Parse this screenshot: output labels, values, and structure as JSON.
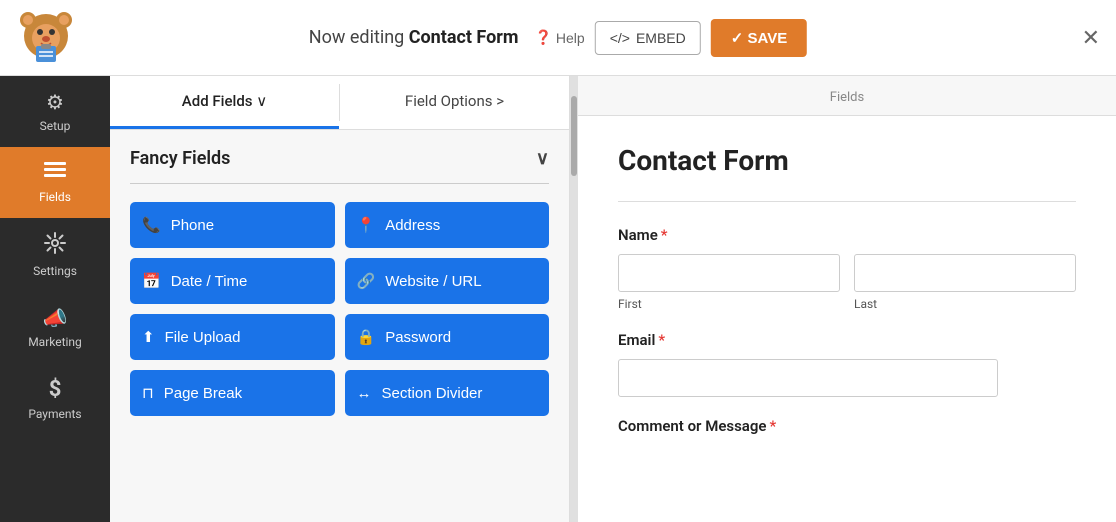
{
  "topbar": {
    "title_prefix": "Now editing ",
    "title_bold": "Contact Form",
    "help_label": "Help",
    "embed_label": "EMBED",
    "save_label": "✓ SAVE",
    "close_label": "✕"
  },
  "sidebar": {
    "items": [
      {
        "id": "setup",
        "label": "Setup",
        "icon": "⚙"
      },
      {
        "id": "fields",
        "label": "Fields",
        "icon": "≡",
        "active": true
      },
      {
        "id": "settings",
        "label": "Settings",
        "icon": "⊞"
      },
      {
        "id": "marketing",
        "label": "Marketing",
        "icon": "📣"
      },
      {
        "id": "payments",
        "label": "Payments",
        "icon": "$"
      }
    ]
  },
  "fields_panel": {
    "tabs": [
      {
        "id": "add-fields",
        "label": "Add Fields ∨",
        "active": true
      },
      {
        "id": "field-options",
        "label": "Field Options >"
      }
    ],
    "fancy_fields_label": "Fancy Fields",
    "buttons": [
      {
        "id": "phone",
        "label": "Phone",
        "icon": "📞"
      },
      {
        "id": "address",
        "label": "Address",
        "icon": "📍"
      },
      {
        "id": "datetime",
        "label": "Date / Time",
        "icon": "📅"
      },
      {
        "id": "website",
        "label": "Website / URL",
        "icon": "🔗"
      },
      {
        "id": "file-upload",
        "label": "File Upload",
        "icon": "⬆"
      },
      {
        "id": "password",
        "label": "Password",
        "icon": "🔒"
      },
      {
        "id": "page-break",
        "label": "Page Break",
        "icon": "⊓"
      },
      {
        "id": "section-divider",
        "label": "Section Divider",
        "icon": "↔"
      }
    ]
  },
  "form_preview": {
    "section_label": "Fields",
    "form_title": "Contact Form",
    "fields": [
      {
        "id": "name",
        "label": "Name",
        "required": true,
        "type": "name",
        "sub_fields": [
          {
            "placeholder": "",
            "sub_label": "First"
          },
          {
            "placeholder": "",
            "sub_label": "Last"
          }
        ]
      },
      {
        "id": "email",
        "label": "Email",
        "required": true,
        "type": "email"
      },
      {
        "id": "comment",
        "label": "Comment or Message",
        "required": true,
        "type": "textarea"
      }
    ]
  }
}
